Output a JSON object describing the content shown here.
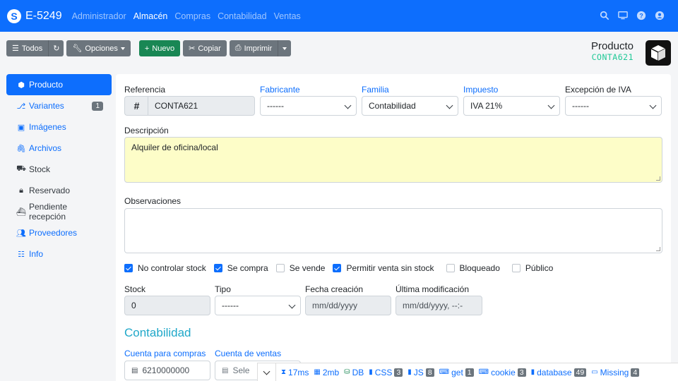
{
  "app": {
    "title": "E-5249",
    "logo_letter": "S"
  },
  "nav": {
    "links": [
      {
        "label": "Administrador"
      },
      {
        "label": "Almacén"
      },
      {
        "label": "Compras"
      },
      {
        "label": "Contabilidad"
      },
      {
        "label": "Ventas"
      }
    ],
    "active": "Almacén",
    "icons": [
      "search-icon",
      "screen-icon",
      "help-icon",
      "user-icon"
    ]
  },
  "toolbar": {
    "all_label": "Todos",
    "options_label": "Opciones",
    "new_label": "Nuevo",
    "copy_label": "Copiar",
    "print_label": "Imprimir"
  },
  "header": {
    "title": "Producto",
    "code": "CONTA621"
  },
  "sidebar": {
    "items": [
      {
        "label": "Producto",
        "icon": "cube-icon"
      },
      {
        "label": "Variantes",
        "icon": "variants-icon",
        "badge": "1"
      },
      {
        "label": "Imágenes",
        "icon": "images-icon"
      },
      {
        "label": "Archivos",
        "icon": "paperclip-icon"
      },
      {
        "label": "Stock",
        "icon": "dolly-icon"
      },
      {
        "label": "Reservado",
        "icon": "lock-icon"
      },
      {
        "label": "Pendiente recepción",
        "icon": "ship-icon"
      },
      {
        "label": "Proveedores",
        "icon": "users-icon"
      },
      {
        "label": "Info",
        "icon": "list-icon"
      }
    ]
  },
  "form": {
    "referencia": {
      "label": "Referencia",
      "value": "CONTA621",
      "addon": "#"
    },
    "fabricante": {
      "label": "Fabricante",
      "value": "------"
    },
    "familia": {
      "label": "Familia",
      "value": "Contabilidad"
    },
    "impuesto": {
      "label": "Impuesto",
      "value": "IVA 21%"
    },
    "excepcion": {
      "label": "Excepción de IVA",
      "value": "------"
    },
    "descripcion": {
      "label": "Descripción",
      "value": "Alquiler de oficina/local"
    },
    "observaciones": {
      "label": "Observaciones",
      "value": ""
    },
    "checks": [
      {
        "label": "No controlar stock",
        "checked": true
      },
      {
        "label": "Se compra",
        "checked": true
      },
      {
        "label": "Se vende",
        "checked": false
      },
      {
        "label": "Permitir venta sin stock",
        "checked": true
      },
      {
        "label": "Bloqueado",
        "checked": false
      },
      {
        "label": "Público",
        "checked": false
      }
    ],
    "stock": {
      "label": "Stock",
      "value": "0"
    },
    "tipo": {
      "label": "Tipo",
      "value": "------"
    },
    "fecha_creacion": {
      "label": "Fecha creación",
      "placeholder": "mm/dd/yyyy"
    },
    "ultima_mod": {
      "label": "Última modificación",
      "placeholder": "mm/dd/yyyy, --:-"
    },
    "section_title": "Contabilidad",
    "cuenta_compras": {
      "label": "Cuenta para compras",
      "value": "6210000000"
    },
    "cuenta_ventas": {
      "label": "Cuenta de ventas",
      "value": "Sele"
    }
  },
  "debugbar": {
    "items": [
      {
        "label": "17ms",
        "icon": "hourglass-icon"
      },
      {
        "label": "2mb",
        "icon": "memory-icon"
      },
      {
        "label": "DB",
        "icon": "database-icon"
      },
      {
        "label": "CSS",
        "icon": "file-icon",
        "count": "3"
      },
      {
        "label": "JS",
        "icon": "file-icon",
        "count": "8"
      },
      {
        "label": "get",
        "icon": "keyboard-icon",
        "count": "1"
      },
      {
        "label": "cookie",
        "icon": "keyboard-icon",
        "count": "3"
      },
      {
        "label": "database",
        "icon": "file-icon",
        "count": "49"
      },
      {
        "label": "Missing",
        "icon": "id-card-icon",
        "count": "4"
      }
    ]
  },
  "colors": {
    "primary": "#0d6efd",
    "success": "#198754",
    "secondary": "#6c757d",
    "accent": "#20c997",
    "highlight": "#fdfdc8"
  }
}
